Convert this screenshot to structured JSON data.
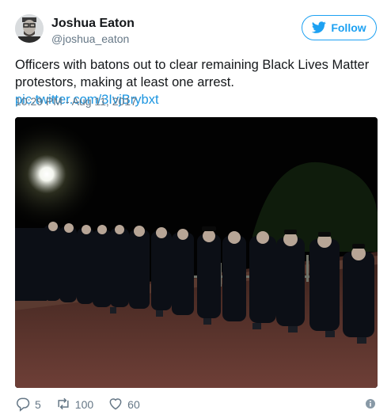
{
  "author": {
    "name": "Joshua Eaton",
    "handle": "@joshua_eaton"
  },
  "follow_label": "Follow",
  "tweet": {
    "text": "Officers with batons out to clear remaining Black Lives Matter protestors, making at least one arrest.",
    "link": "pic.twitter.com/3IvjBrybxt",
    "timestamp": "10:29 PM - Aug 11, 2017"
  },
  "actions": {
    "replies": "5",
    "retweets": "100",
    "likes": "60"
  },
  "icons": {
    "follow": "twitter-bird-icon",
    "reply": "reply-icon",
    "retweet": "retweet-icon",
    "like": "heart-icon",
    "info": "info-icon"
  },
  "colors": {
    "accent": "#1da1f2",
    "link": "#1b95e0",
    "muted": "#657786"
  }
}
